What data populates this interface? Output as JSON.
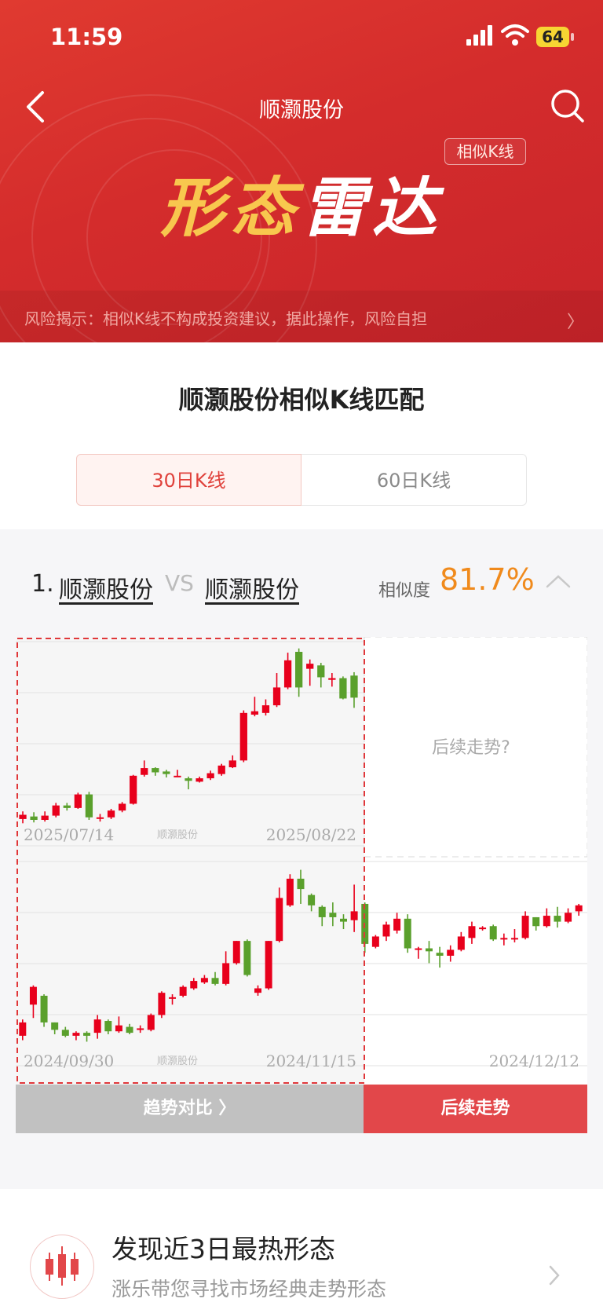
{
  "status_bar": {
    "time": "11:59",
    "battery": "64"
  },
  "nav": {
    "title": "顺灏股份",
    "back_icon": "chevron-left-icon",
    "search_icon": "search-icon"
  },
  "hero": {
    "tag": "相似K线",
    "brand_part1": "形态",
    "brand_part2": "雷达",
    "risk_notice": "风险揭示：相似K线不构成投资建议，据此操作，风险自担"
  },
  "match": {
    "title": "顺灏股份相似K线匹配",
    "tabs": [
      {
        "label": "30日K线",
        "active": true
      },
      {
        "label": "60日K线",
        "active": false
      }
    ]
  },
  "result": {
    "index": "1.",
    "stock_a": "顺灏股份",
    "vs": "VS",
    "stock_b": "顺灏股份",
    "similarity_label": "相似度",
    "similarity_value": "81.7%"
  },
  "chart_data": [
    {
      "type": "candlestick",
      "name": "current",
      "watermark": "顺灏股份",
      "x_start": "2025/07/14",
      "x_end": "2025/08/22",
      "future_placeholder": "后续走势?",
      "candles": [
        [
          10.0,
          10.5,
          10.9,
          9.5
        ],
        [
          10.3,
          9.9,
          10.8,
          9.6
        ],
        [
          9.9,
          10.4,
          10.9,
          9.7
        ],
        [
          10.4,
          11.6,
          11.9,
          10.2
        ],
        [
          11.6,
          11.3,
          11.9,
          11.0
        ],
        [
          11.3,
          12.9,
          13.1,
          11.2
        ],
        [
          12.9,
          10.2,
          13.2,
          9.9
        ],
        [
          10.2,
          10.2,
          10.6,
          9.7
        ],
        [
          10.2,
          11.0,
          11.2,
          10.0
        ],
        [
          11.0,
          11.8,
          12.0,
          10.8
        ],
        [
          11.8,
          15.1,
          15.2,
          11.7
        ],
        [
          15.2,
          16.0,
          16.9,
          15.0
        ],
        [
          16.0,
          15.5,
          16.1,
          15.1
        ],
        [
          15.6,
          15.3,
          15.8,
          14.9
        ],
        [
          15.1,
          15.1,
          15.8,
          15.0
        ],
        [
          14.8,
          14.5,
          15.0,
          13.5
        ],
        [
          14.4,
          14.8,
          15.0,
          14.3
        ],
        [
          14.8,
          15.4,
          15.7,
          14.6
        ],
        [
          15.3,
          16.3,
          16.5,
          15.1
        ],
        [
          16.1,
          16.9,
          17.5,
          16.0
        ],
        [
          16.9,
          22.5,
          22.8,
          16.7
        ],
        [
          22.3,
          22.7,
          24.4,
          22.1
        ],
        [
          22.5,
          23.4,
          24.1,
          22.2
        ],
        [
          23.4,
          25.5,
          27.2,
          23.2
        ],
        [
          25.5,
          28.7,
          29.6,
          25.3
        ],
        [
          29.7,
          25.5,
          30.1,
          24.4
        ],
        [
          27.7,
          28.3,
          28.8,
          25.7
        ],
        [
          28.1,
          26.7,
          28.4,
          25.5
        ],
        [
          26.4,
          26.6,
          27.2,
          25.6
        ],
        [
          26.6,
          24.2,
          26.8,
          24.1
        ],
        [
          26.9,
          24.3,
          27.3,
          23.1
        ]
      ]
    },
    {
      "type": "candlestick",
      "name": "history_match",
      "watermark": "顺灏股份",
      "x_start": "2024/09/30",
      "x_mid": "2024/11/15",
      "x_end": "2024/12/12",
      "candles": [
        [
          4.0,
          4.9,
          5.1,
          3.7
        ],
        [
          6.1,
          7.3,
          7.4,
          5.2
        ],
        [
          6.7,
          4.9,
          6.8,
          4.6
        ],
        [
          4.9,
          4.4,
          4.9,
          4.1
        ],
        [
          4.4,
          4.0,
          4.6,
          3.9
        ],
        [
          4.0,
          4.2,
          4.3,
          3.7
        ],
        [
          4.2,
          4.0,
          4.3,
          3.6
        ],
        [
          4.2,
          5.1,
          5.4,
          3.8
        ],
        [
          5.0,
          4.3,
          5.1,
          4.1
        ],
        [
          4.3,
          4.7,
          5.3,
          4.2
        ],
        [
          4.6,
          4.2,
          4.8,
          4.1
        ],
        [
          4.4,
          4.5,
          4.7,
          4.2
        ],
        [
          4.4,
          5.4,
          5.5,
          4.3
        ],
        [
          5.4,
          6.9,
          7.0,
          5.2
        ],
        [
          6.5,
          6.6,
          6.8,
          6.1
        ],
        [
          6.7,
          7.3,
          7.4,
          6.6
        ],
        [
          7.2,
          7.7,
          7.9,
          7.1
        ],
        [
          7.6,
          7.9,
          8.1,
          7.5
        ],
        [
          7.9,
          7.5,
          8.3,
          7.4
        ],
        [
          7.5,
          8.9,
          9.7,
          7.4
        ],
        [
          8.9,
          10.4,
          10.4,
          8.8
        ],
        [
          10.4,
          8.1,
          10.5,
          8.0
        ],
        [
          6.9,
          7.2,
          7.4,
          6.7
        ],
        [
          7.2,
          10.4,
          10.4,
          7.1
        ],
        [
          10.4,
          13.3,
          14.0,
          10.3
        ],
        [
          12.8,
          14.6,
          14.9,
          12.7
        ],
        [
          14.6,
          13.9,
          15.2,
          12.9
        ],
        [
          13.5,
          12.8,
          13.6,
          12.4
        ],
        [
          12.7,
          12.0,
          12.8,
          11.4
        ],
        [
          12.3,
          12.0,
          13.0,
          11.4
        ],
        [
          11.9,
          11.7,
          12.2,
          11.2
        ],
        [
          11.8,
          12.4,
          14.2,
          11.0
        ],
        [
          12.9,
          10.2,
          13.0,
          9.6
        ],
        [
          10.0,
          10.7,
          10.8,
          9.9
        ],
        [
          10.7,
          11.5,
          11.7,
          10.4
        ],
        [
          11.1,
          11.9,
          12.3,
          10.9
        ],
        [
          11.9,
          9.9,
          12.2,
          9.6
        ],
        [
          9.9,
          9.9,
          10.0,
          9.2
        ],
        [
          9.9,
          9.7,
          10.4,
          8.9
        ],
        [
          9.6,
          9.4,
          10.0,
          8.6
        ],
        [
          9.4,
          9.8,
          10.1,
          9.0
        ],
        [
          9.8,
          10.7,
          11.0,
          9.7
        ],
        [
          10.6,
          11.4,
          11.7,
          10.2
        ],
        [
          11.3,
          11.3,
          11.4,
          11.1
        ],
        [
          11.4,
          10.5,
          11.5,
          10.4
        ],
        [
          10.5,
          10.6,
          10.9,
          10.1
        ],
        [
          10.6,
          10.6,
          11.2,
          10.3
        ],
        [
          10.6,
          12.1,
          12.4,
          10.5
        ],
        [
          12.0,
          11.4,
          12.0,
          11.1
        ],
        [
          11.4,
          12.1,
          12.6,
          11.3
        ],
        [
          12.1,
          11.7,
          12.7,
          11.3
        ],
        [
          11.7,
          12.3,
          12.6,
          11.6
        ],
        [
          12.4,
          12.8,
          12.9,
          12.1
        ]
      ]
    }
  ],
  "actions": {
    "compare_label": "趋势对比 〉",
    "follow_label": "后续走势"
  },
  "hot": {
    "title": "发现近3日最热形态",
    "subtitle": "涨乐带您寻找市场经典走势形态"
  },
  "colors": {
    "up": "#e8001c",
    "down": "#5aa02c",
    "accent": "#f08a1c",
    "brand_red": "#d42c2c"
  }
}
